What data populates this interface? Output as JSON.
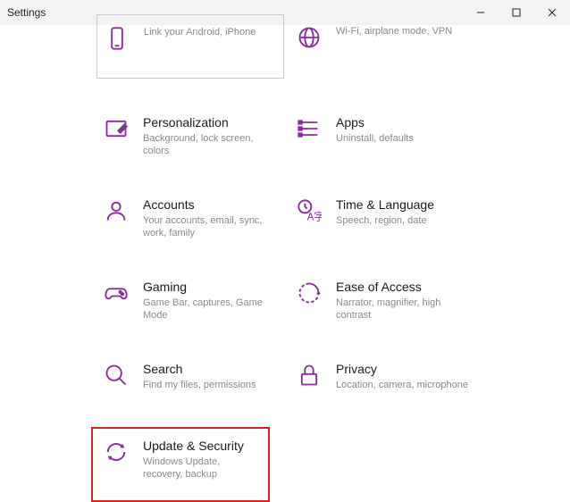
{
  "window": {
    "title": "Settings"
  },
  "tiles": {
    "phone": {
      "title": "",
      "sub": "Link your Android, iPhone"
    },
    "network": {
      "title": "",
      "sub": "Wi-Fi, airplane mode, VPN"
    },
    "personalization": {
      "title": "Personalization",
      "sub": "Background, lock screen, colors"
    },
    "apps": {
      "title": "Apps",
      "sub": "Uninstall, defaults"
    },
    "accounts": {
      "title": "Accounts",
      "sub": "Your accounts, email, sync, work, family"
    },
    "time": {
      "title": "Time & Language",
      "sub": "Speech, region, date"
    },
    "gaming": {
      "title": "Gaming",
      "sub": "Game Bar, captures, Game Mode"
    },
    "ease": {
      "title": "Ease of Access",
      "sub": "Narrator, magnifier, high contrast"
    },
    "search": {
      "title": "Search",
      "sub": "Find my files, permissions"
    },
    "privacy": {
      "title": "Privacy",
      "sub": "Location, camera, microphone"
    },
    "update": {
      "title": "Update & Security",
      "sub": "Windows Update, recovery, backup"
    }
  }
}
